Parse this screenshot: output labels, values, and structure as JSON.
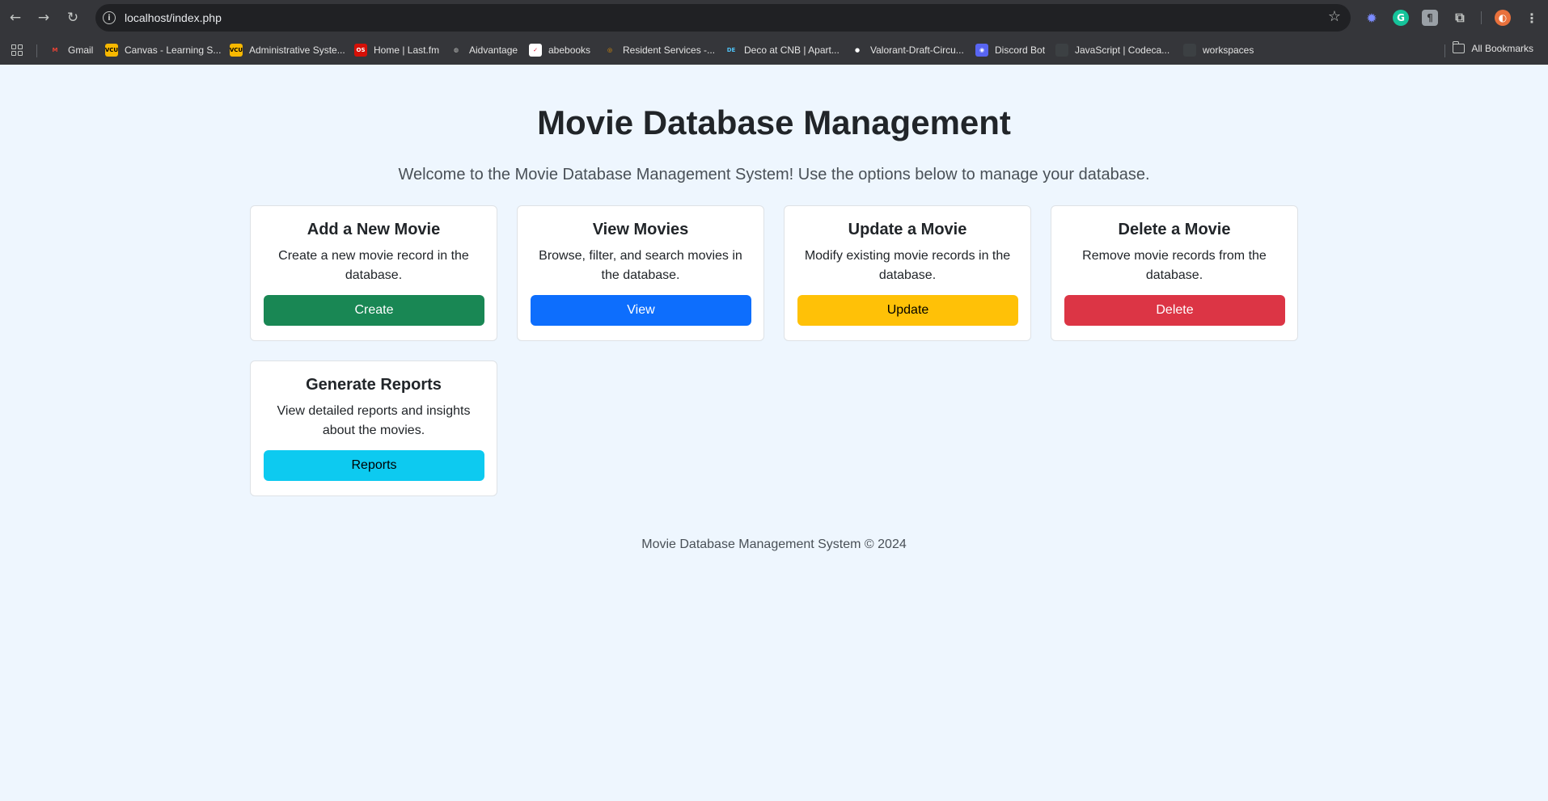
{
  "browser": {
    "url": "localhost/index.php",
    "bookmarks": [
      {
        "label": "Gmail",
        "icon": "gmail-icon",
        "icon_text": "M",
        "color": "#ea4335",
        "bg": "transparent"
      },
      {
        "label": "Canvas - Learning S...",
        "icon": "vcu-icon",
        "icon_text": "VCU",
        "color": "#000000",
        "bg": "#f8b800"
      },
      {
        "label": "Administrative Syste...",
        "icon": "vcu-icon",
        "icon_text": "VCU",
        "color": "#000000",
        "bg": "#f8b800"
      },
      {
        "label": "Home | Last.fm",
        "icon": "lastfm-icon",
        "icon_text": "OS",
        "color": "#ffffff",
        "bg": "#d51007"
      },
      {
        "label": "Aidvantage",
        "icon": "globe-icon",
        "icon_text": "◍",
        "color": "#c4c7c5",
        "bg": "transparent"
      },
      {
        "label": "abebooks",
        "icon": "abebooks-icon",
        "icon_text": "✓",
        "color": "#d2102e",
        "bg": "#ffffff"
      },
      {
        "label": "Resident Services -...",
        "icon": "resident-icon",
        "icon_text": "◎",
        "color": "#f29900",
        "bg": "transparent"
      },
      {
        "label": "Deco at CNB | Apart...",
        "icon": "deco-icon",
        "icon_text": "DE",
        "color": "#4fc3f7",
        "bg": "transparent"
      },
      {
        "label": "Valorant-Draft-Circu...",
        "icon": "github-icon",
        "icon_text": "●",
        "color": "#ffffff",
        "bg": "transparent"
      },
      {
        "label": "Discord Bot",
        "icon": "discord-icon",
        "icon_text": "◉",
        "color": "#ffffff",
        "bg": "#5865f2"
      },
      {
        "label": "JavaScript | Codeca...",
        "icon": "codecademy-icon",
        "icon_text": "",
        "color": "#c4c7c5",
        "bg": "#3c4043"
      },
      {
        "label": "workspaces",
        "icon": "workspaces-icon",
        "icon_text": "",
        "color": "#c4c7c5",
        "bg": "#3c4043"
      }
    ],
    "all_bookmarks": "All Bookmarks"
  },
  "page": {
    "title": "Movie Database Management",
    "subtitle": "Welcome to the Movie Database Management System! Use the options below to manage your database.",
    "cards": [
      {
        "title": "Add a New Movie",
        "text": "Create a new movie record in the database.",
        "button": "Create",
        "button_color": "#198754"
      },
      {
        "title": "View Movies",
        "text": "Browse, filter, and search movies in the database.",
        "button": "View",
        "button_color": "#0d6efd"
      },
      {
        "title": "Update a Movie",
        "text": "Modify existing movie records in the database.",
        "button": "Update",
        "button_color": "#ffc107"
      },
      {
        "title": "Delete a Movie",
        "text": "Remove movie records from the database.",
        "button": "Delete",
        "button_color": "#dc3545"
      },
      {
        "title": "Generate Reports",
        "text": "View detailed reports and insights about the movies.",
        "button": "Reports",
        "button_color": "#0dcaf0"
      }
    ],
    "footer": "Movie Database Management System © 2024"
  }
}
